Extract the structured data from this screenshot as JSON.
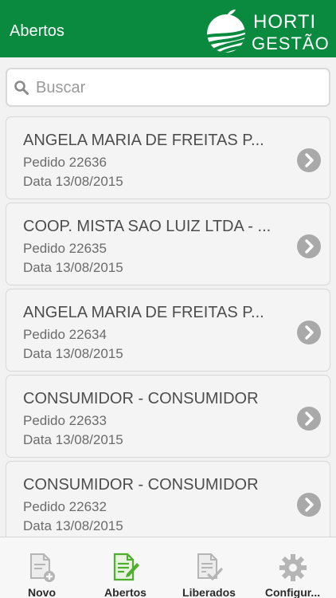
{
  "header": {
    "title": "Abertos"
  },
  "logo": {
    "line1": "HORTI",
    "line2": "GESTÃO"
  },
  "search": {
    "placeholder": "Buscar",
    "value": ""
  },
  "orders": [
    {
      "customer": "ANGELA MARIA DE FREITAS P...",
      "pedido": "Pedido 22636",
      "data": "Data 13/08/2015"
    },
    {
      "customer": "COOP. MISTA SAO LUIZ LTDA - ...",
      "pedido": "Pedido 22635",
      "data": "Data 13/08/2015"
    },
    {
      "customer": "ANGELA MARIA DE FREITAS P...",
      "pedido": "Pedido 22634",
      "data": "Data 13/08/2015"
    },
    {
      "customer": "CONSUMIDOR - CONSUMIDOR",
      "pedido": "Pedido 22633",
      "data": "Data 13/08/2015"
    },
    {
      "customer": "CONSUMIDOR - CONSUMIDOR",
      "pedido": "Pedido 22632",
      "data": "Data 13/08/2015"
    }
  ],
  "tabs": [
    {
      "label": "Novo",
      "icon": "new-document-icon",
      "active": false
    },
    {
      "label": "Abertos",
      "icon": "edit-document-icon",
      "active": true
    },
    {
      "label": "Liberados",
      "icon": "checked-document-icon",
      "active": false
    },
    {
      "label": "Configur...",
      "icon": "gear-icon",
      "active": false
    }
  ],
  "colors": {
    "brand": "#0a8a3e",
    "tab_active": "#4fae2c",
    "tab_inactive": "#b5b5b5"
  }
}
